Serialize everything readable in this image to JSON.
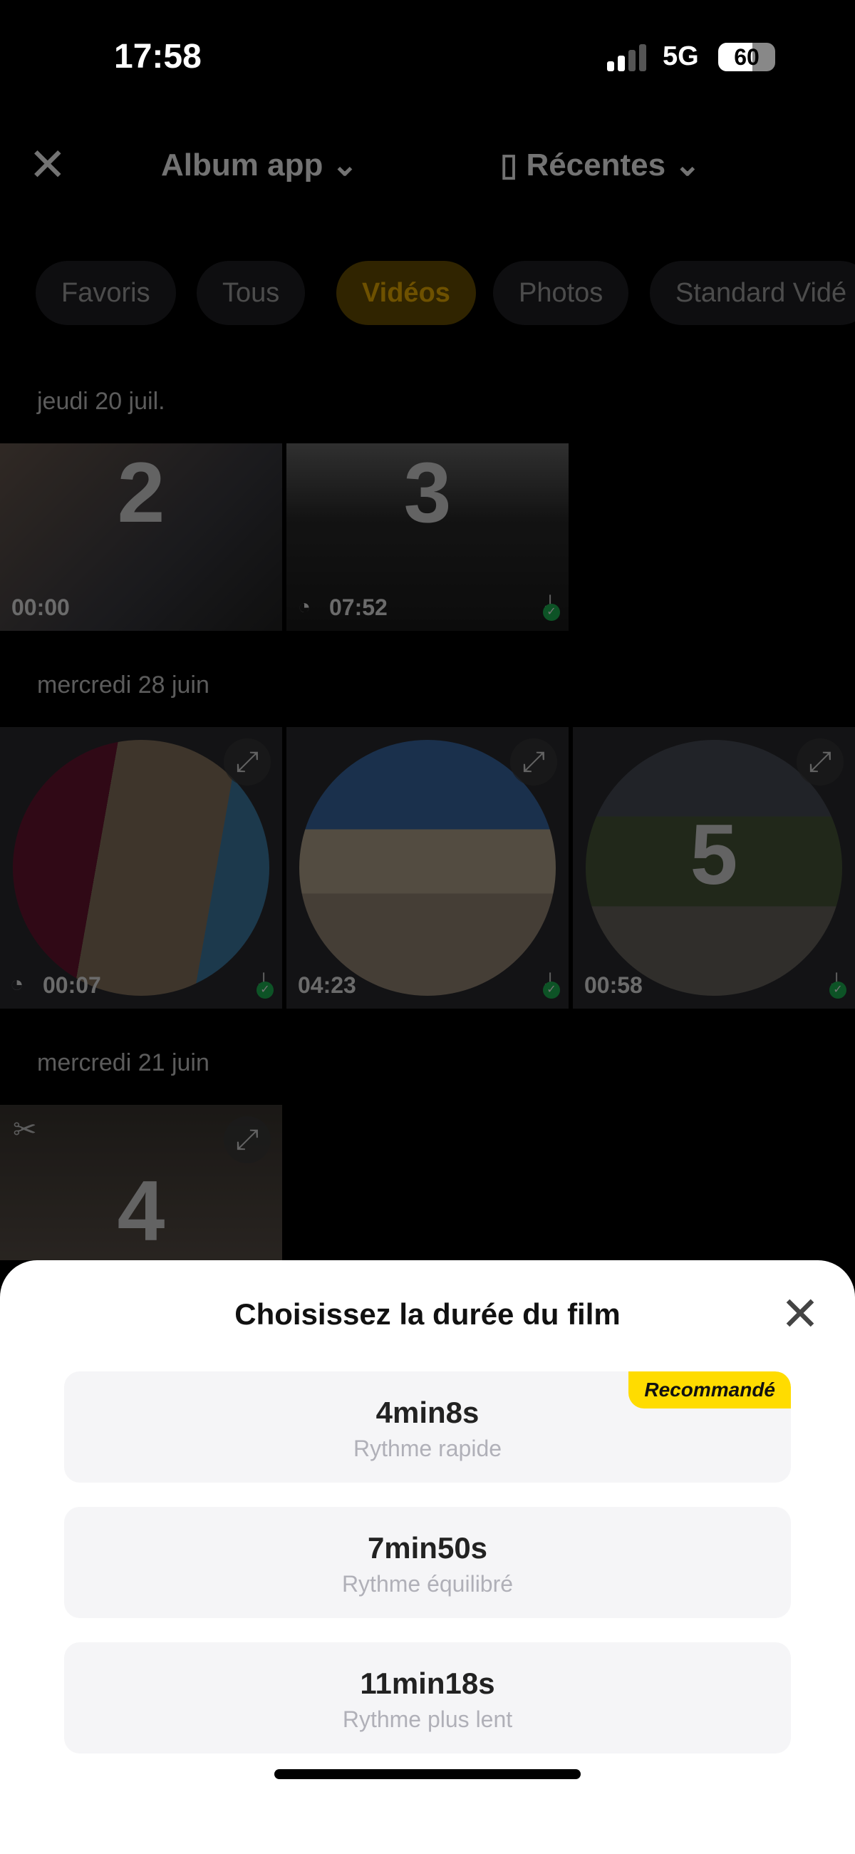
{
  "status_bar": {
    "time": "17:58",
    "network": "5G",
    "battery": "60"
  },
  "header": {
    "close_icon": "close-icon",
    "album": "Album app",
    "source": "Récentes"
  },
  "filters": [
    {
      "label": "Favoris"
    },
    {
      "label": "Tous"
    },
    {
      "label": "Vidéos",
      "active": true
    },
    {
      "label": "Photos"
    },
    {
      "label": "Standard Vidé"
    }
  ],
  "sections": [
    {
      "date": "jeudi 20 juil.",
      "items": [
        {
          "number": "2",
          "duration": "00:00"
        },
        {
          "number": "3",
          "duration": "07:52"
        }
      ]
    },
    {
      "date": "mercredi 28 juin",
      "items": [
        {
          "duration": "00:07"
        },
        {
          "duration": "04:23"
        },
        {
          "number": "5",
          "duration": "00:58"
        }
      ]
    },
    {
      "date": "mercredi 21 juin",
      "items": [
        {
          "number": "4"
        }
      ]
    }
  ],
  "sheet": {
    "title": "Choisissez la durée du film",
    "options": [
      {
        "duration": "4min8s",
        "pace": "Rythme rapide",
        "badge": "Recommandé"
      },
      {
        "duration": "7min50s",
        "pace": "Rythme équilibré"
      },
      {
        "duration": "11min18s",
        "pace": "Rythme plus lent"
      }
    ]
  },
  "colors": {
    "accent": "#f5b400",
    "badge": "#ffdc00",
    "download_ok": "#1db954"
  }
}
